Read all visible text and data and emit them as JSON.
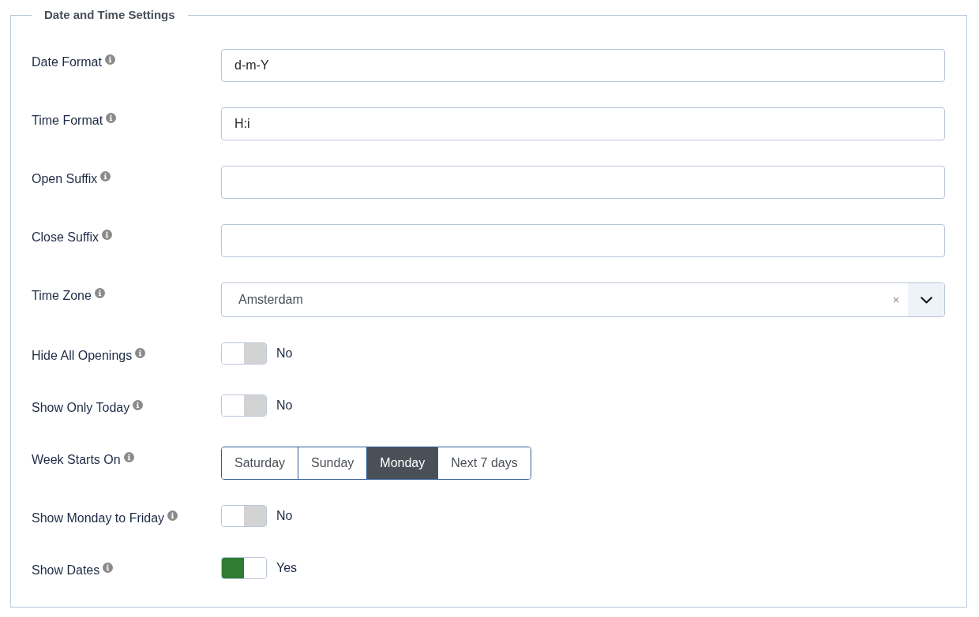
{
  "settings": {
    "legend": "Date and Time Settings",
    "fields": [
      {
        "kind": "text",
        "label": "Date Format",
        "value": "d-m-Y"
      },
      {
        "kind": "text",
        "label": "Time Format",
        "value": "H:i"
      },
      {
        "kind": "text",
        "label": "Open Suffix"
      },
      {
        "kind": "text",
        "label": "Close Suffix"
      },
      {
        "kind": "select",
        "label": "Time Zone",
        "value": "Amsterdam"
      },
      {
        "kind": "switch",
        "label": "Hide All Openings",
        "on": false,
        "state_text": "No"
      },
      {
        "kind": "switch",
        "label": "Show Only Today",
        "on": false,
        "state_text": "No"
      },
      {
        "kind": "segmented",
        "label": "Week Starts On",
        "options": [
          {
            "label": "Saturday",
            "selected": false
          },
          {
            "label": "Sunday",
            "selected": false
          },
          {
            "label": "Monday",
            "selected": true
          },
          {
            "label": "Next 7 days",
            "selected": false
          }
        ]
      },
      {
        "kind": "switch",
        "label": "Show Monday to Friday",
        "on": false,
        "state_text": "No"
      },
      {
        "kind": "switch",
        "label": "Show Dates",
        "on": true,
        "state_text": "Yes"
      }
    ]
  }
}
